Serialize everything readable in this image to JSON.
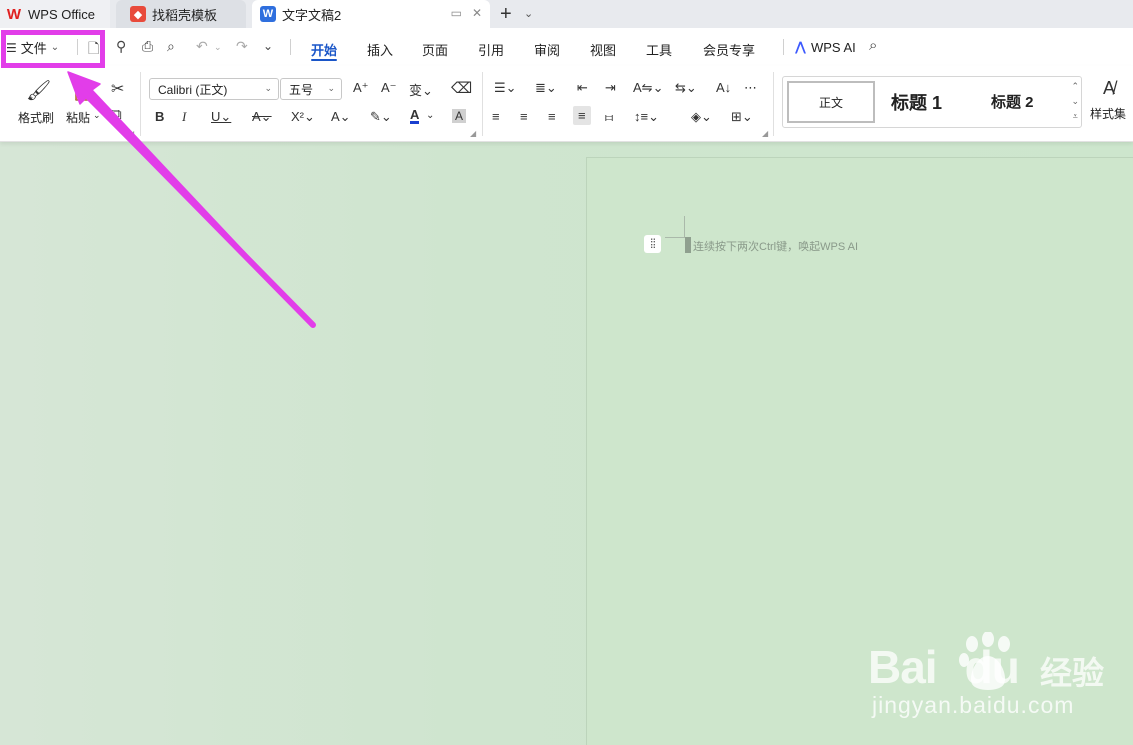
{
  "tabs": {
    "home": "WPS Office",
    "template": "找稻壳模板",
    "document": "文字文稿2"
  },
  "menu": {
    "file": "文件",
    "items": [
      "开始",
      "插入",
      "页面",
      "引用",
      "审阅",
      "视图",
      "工具",
      "会员专享"
    ],
    "active": "开始",
    "wps_ai": "WPS AI"
  },
  "ribbon": {
    "format_painter": "格式刷",
    "paste": "粘贴",
    "font_name": "Calibri (正文)",
    "font_size": "五号",
    "styles": [
      "正文",
      "标题 1",
      "标题 2"
    ],
    "style_set": "样式集"
  },
  "document": {
    "ai_hint": "连续按下两次Ctrl键，唤起WPS AI"
  },
  "watermark": {
    "brand": "Baidu经验",
    "url": "jingyan.baidu.com"
  },
  "colors": {
    "accent": "#1a56c8",
    "highlight": "#e23de9",
    "doc_background": "#cee6cc",
    "font_color_bar": "#1a3fcf"
  }
}
